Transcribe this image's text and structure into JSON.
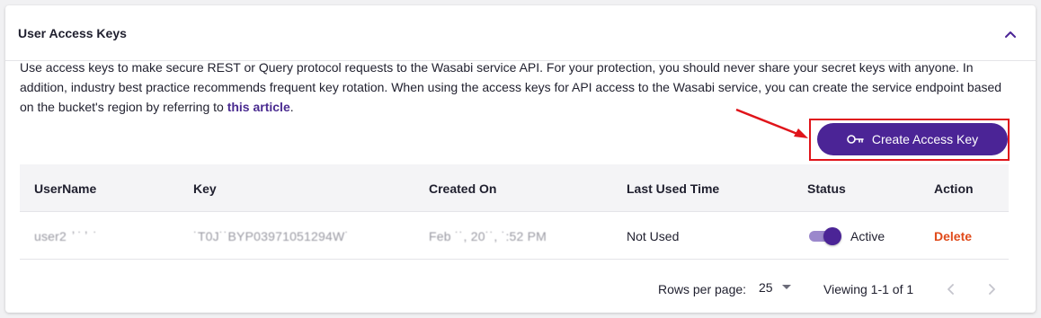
{
  "panel": {
    "title": "User Access Keys",
    "description_text": "Use access keys to make secure REST or Query protocol requests to the Wasabi service API. For your protection, you should never share your secret keys with anyone. In addition, industry best practice recommends frequent key rotation. When using the access keys for API access to the Wasabi service, you can create the service endpoint based on the bucket's region by referring to ",
    "description_link": "this article",
    "description_end": "."
  },
  "actions": {
    "create_label": "Create Access Key"
  },
  "table": {
    "headers": [
      "UserName",
      "Key",
      "Created On",
      "Last Used Time",
      "Status",
      "Action"
    ],
    "rows": [
      {
        "username": "user2  ʼ ˙ ʼ  ˙ ",
        "key": "˙T0J˙˙BYP03971051294W˙",
        "created_on": "Feb ˙˙, 20˙˙, ˙:52 PM",
        "last_used": "Not Used",
        "status": "Active",
        "action": "Delete"
      }
    ]
  },
  "pagination": {
    "rows_per_page_label": "Rows per page:",
    "rows_per_page_value": "25",
    "viewing": "Viewing 1-1 of 1"
  },
  "colors": {
    "brand_purple": "#4b2496",
    "toggle_track": "#9b88cc",
    "delete": "#e04a1a",
    "annotation_red": "#e0141a",
    "link": "#4a2b90"
  },
  "icons": {
    "collapse": "chevron-up-icon",
    "create": "key-icon",
    "rows_select": "caret-down-icon",
    "prev": "chevron-left-icon",
    "next": "chevron-right-icon"
  }
}
